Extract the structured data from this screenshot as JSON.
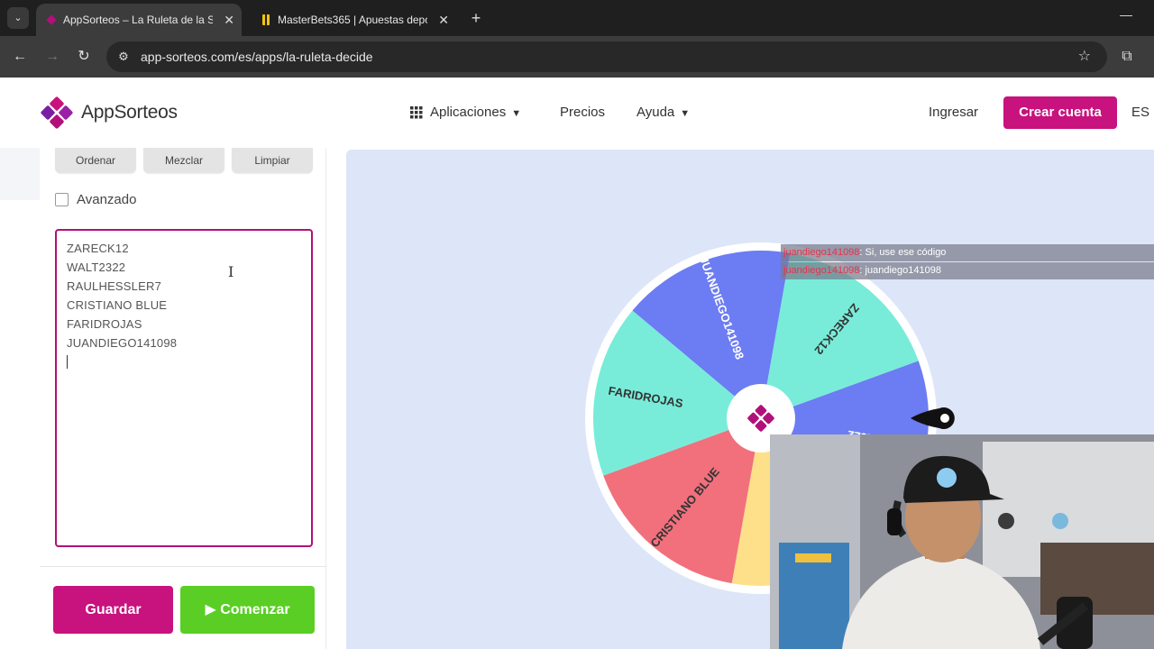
{
  "browser": {
    "tabs": [
      {
        "title": "AppSorteos – La Ruleta de la Su",
        "active": true
      },
      {
        "title": "MasterBets365 | Apuestas depo",
        "active": false
      }
    ],
    "url": "app-sorteos.com/es/apps/la-ruleta-decide"
  },
  "header": {
    "brand_left": "App",
    "brand_right": "Sorteos",
    "nav": {
      "apps": "Aplicaciones",
      "pricing": "Precios",
      "help": "Ayuda"
    },
    "login": "Ingresar",
    "create_account": "Crear cuenta",
    "lang": "ES"
  },
  "panel": {
    "buttons": {
      "sort": "Ordenar",
      "shuffle": "Mezclar",
      "clear": "Limpiar"
    },
    "advanced_label": "Avanzado",
    "names": [
      "ZARECK12",
      "WALT2322",
      "RAULHESSLER7",
      "CRISTIANO BLUE",
      "FARIDROJAS",
      "JUANDIEGO141098"
    ],
    "save": "Guardar",
    "start": "Comenzar"
  },
  "wheel": {
    "segments": [
      {
        "label": "ZARECK12",
        "color": "#78ecd9"
      },
      {
        "label": "WALT2322",
        "color": "#6c7cf2"
      },
      {
        "label": "RAULHESSLER7",
        "color": "#ffe08a"
      },
      {
        "label": "CRISTIANO BLUE",
        "color": "#f1707c"
      },
      {
        "label": "FARIDROJAS",
        "color": "#78ecd9"
      },
      {
        "label": "JUANDIEGO141098",
        "color": "#6c7cf2"
      }
    ],
    "brand_color": "#b1107a"
  },
  "chat": [
    {
      "user": "juandiego141098",
      "text": ": Si, use ese código"
    },
    {
      "user": "juandiego141098",
      "text": ": juandiego141098"
    }
  ]
}
